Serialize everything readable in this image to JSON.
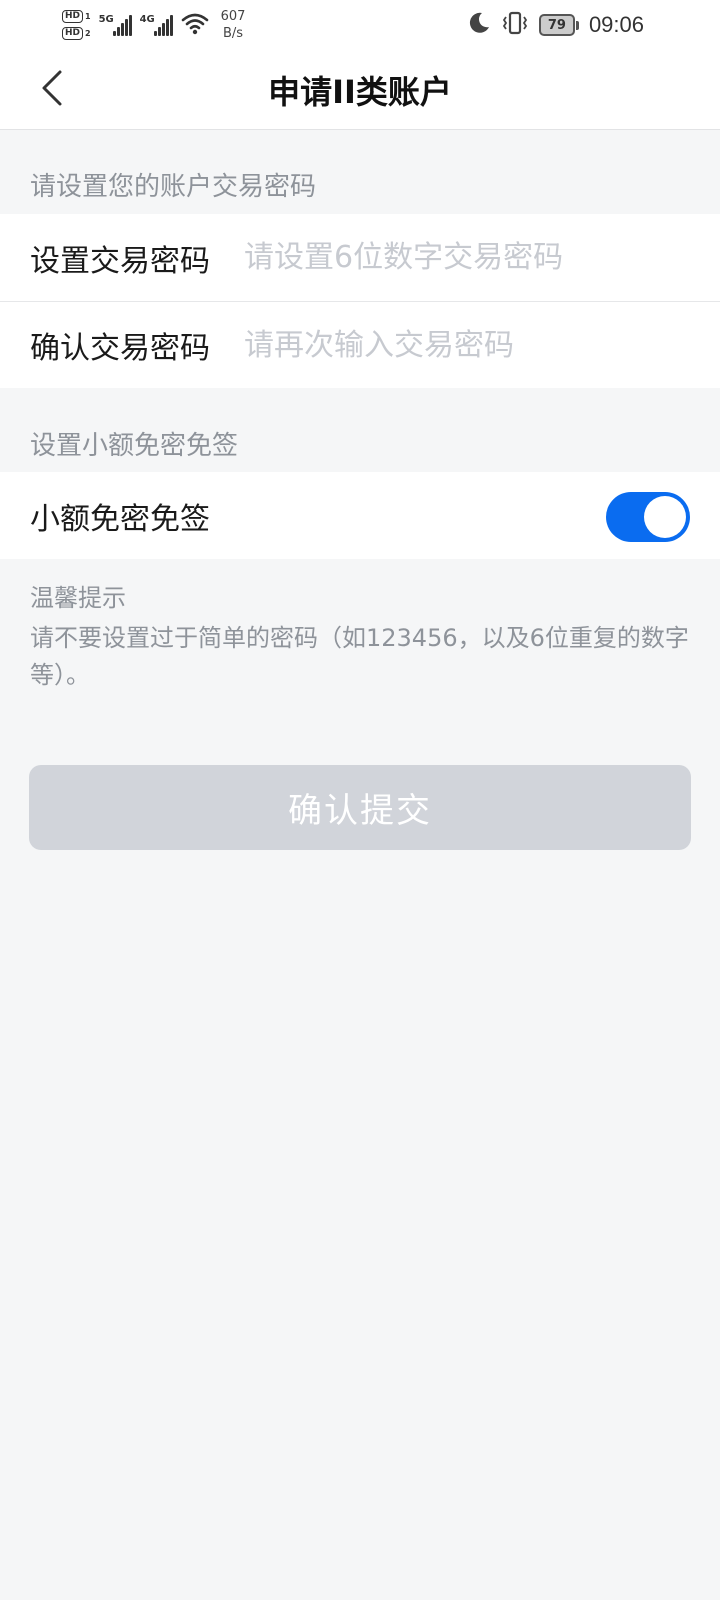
{
  "status_bar": {
    "hd1": "HD",
    "hd1_sim": "1",
    "hd2": "HD",
    "hd2_sim": "2",
    "net1": "5G",
    "net2": "4G",
    "speed_value": "607",
    "speed_unit": "B/s",
    "battery": "79",
    "time": "09:06",
    "icons": [
      "moon-icon",
      "vibrate-icon",
      "wifi-icon",
      "signal-icon",
      "battery-icon"
    ]
  },
  "nav": {
    "title": "申请II类账户",
    "back_icon": "chevron-left-icon"
  },
  "password_section": {
    "label": "请设置您的账户交易密码",
    "rows": [
      {
        "label": "设置交易密码",
        "placeholder": "请设置6位数字交易密码",
        "value": ""
      },
      {
        "label": "确认交易密码",
        "placeholder": "请再次输入交易密码",
        "value": ""
      }
    ]
  },
  "micro_section": {
    "label": "设置小额免密免签",
    "toggle_label": "小额免密免签",
    "toggle_on": true,
    "toggle_color": "#0a6cf0"
  },
  "tips": {
    "title": "温馨提示",
    "body": "请不要设置过于简单的密码（如123456，以及6位重复的数字等）。"
  },
  "submit": {
    "label": "确认提交",
    "enabled": false
  },
  "colors": {
    "background": "#f5f6f7",
    "accent": "#0a6cf0",
    "button_disabled": "#d1d4da",
    "muted_text": "#8e939a"
  }
}
